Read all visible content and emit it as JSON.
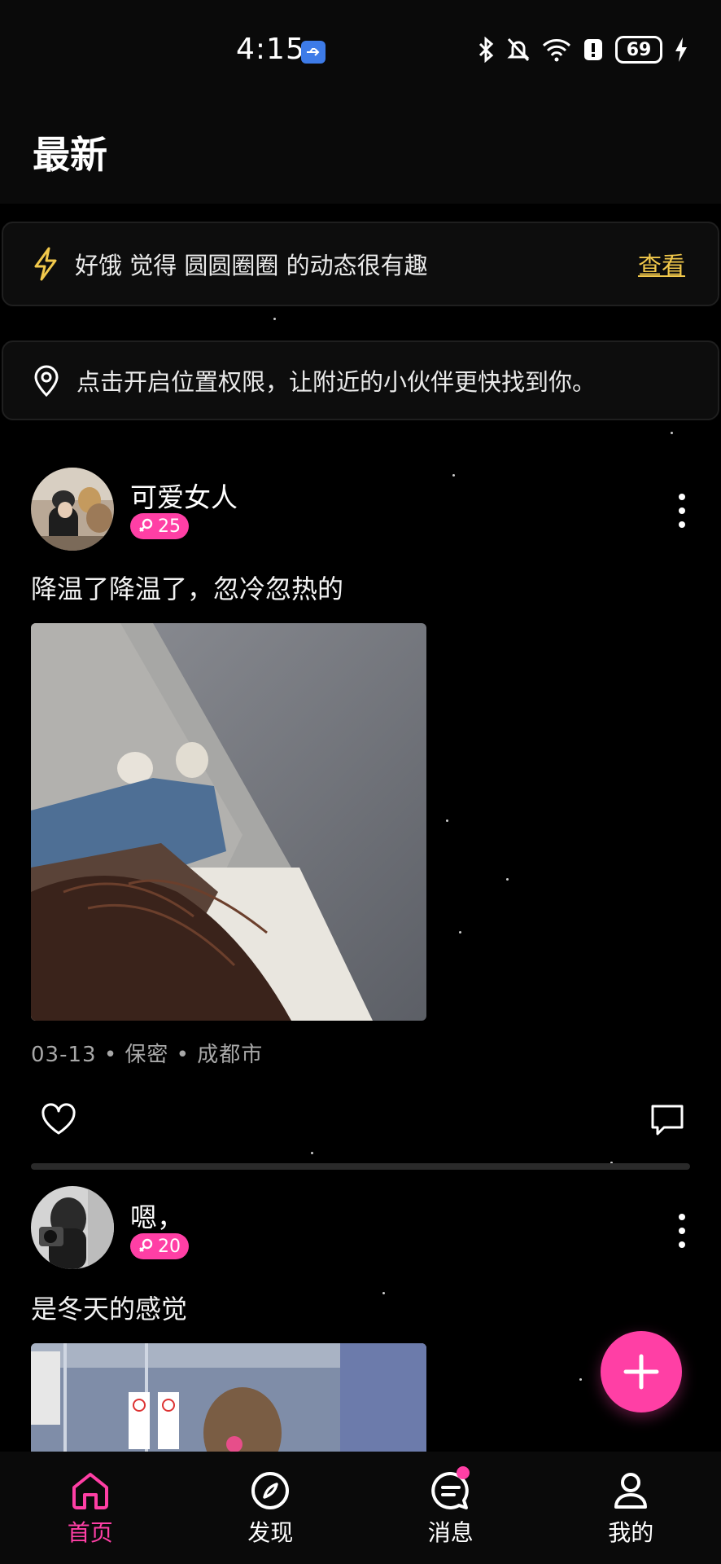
{
  "status_bar": {
    "time": "4:15",
    "battery": "69"
  },
  "header": {
    "title": "最新"
  },
  "notice_banner": {
    "text": "好饿 觉得 圆圆圈圈 的动态很有趣",
    "link_label": "查看"
  },
  "location_banner": {
    "text": "点击开启位置权限，让附近的小伙伴更快找到你。"
  },
  "posts": [
    {
      "username": "可爱女人",
      "age": "25",
      "gender_icon": "female-icon",
      "text": "降温了降温了，忽冷忽热的",
      "meta": "03-13 • 保密 • 成都市"
    },
    {
      "username": "嗯，",
      "age": "20",
      "gender_icon": "female-icon",
      "text": "是冬天的感觉"
    }
  ],
  "tabbar": {
    "items": [
      {
        "label": "首页",
        "icon": "home-icon",
        "active": true
      },
      {
        "label": "发现",
        "icon": "compass-icon",
        "active": false
      },
      {
        "label": "消息",
        "icon": "chat-icon",
        "active": false
      },
      {
        "label": "我的",
        "icon": "profile-icon",
        "active": false
      }
    ]
  },
  "colors": {
    "accent": "#ff3fa5",
    "link": "#f1c84b",
    "background": "#000000"
  }
}
